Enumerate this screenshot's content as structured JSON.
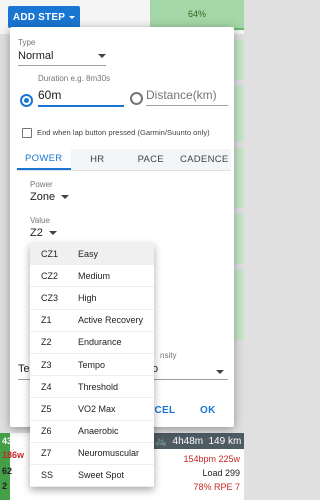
{
  "toolbar": {
    "add_step_label": "ADD STEP",
    "progress_pct": "64%"
  },
  "dialog": {
    "type_label": "Type",
    "type_value": "Normal",
    "duration_label": "Duration e.g. 8m30s",
    "duration_value": "60m",
    "distance_placeholder": "Distance(km)",
    "lap_checkbox_label": "End when lap button pressed (Garmin/Suunto only)",
    "tabs": [
      "POWER",
      "HR",
      "PACE",
      "CADENCE"
    ],
    "power_label": "Power",
    "power_value": "Zone",
    "value_label": "Value",
    "value_value": "Z2",
    "intensity_label_fragment": "nsity",
    "text_fragment_left": "Te",
    "text_fragment_right": "o",
    "cancel_fragment": "NCEL",
    "ok_label": "OK"
  },
  "zone_menu": [
    {
      "code": "CZ1",
      "name": "Easy",
      "selected": true
    },
    {
      "code": "CZ2",
      "name": "Medium"
    },
    {
      "code": "CZ3",
      "name": "High"
    },
    {
      "code": "Z1",
      "name": "Active Recovery"
    },
    {
      "code": "Z2",
      "name": "Endurance"
    },
    {
      "code": "Z3",
      "name": "Tempo"
    },
    {
      "code": "Z4",
      "name": "Threshold"
    },
    {
      "code": "Z5",
      "name": "VO2 Max"
    },
    {
      "code": "Z6",
      "name": "Anaerobic"
    },
    {
      "code": "Z7",
      "name": "Neuromuscular"
    },
    {
      "code": "SS",
      "name": "Sweet Spot"
    }
  ],
  "background": {
    "left_values": [
      "43",
      "186w",
      "62",
      "2"
    ],
    "ride_time": "4h48m",
    "ride_distance": "149 km",
    "ride_power": "154bpm 225w",
    "ride_load": "Load 299",
    "ride_rpe": "78% RPE 7"
  },
  "colors": {
    "accent": "#1976d2",
    "green": "#43a047"
  }
}
